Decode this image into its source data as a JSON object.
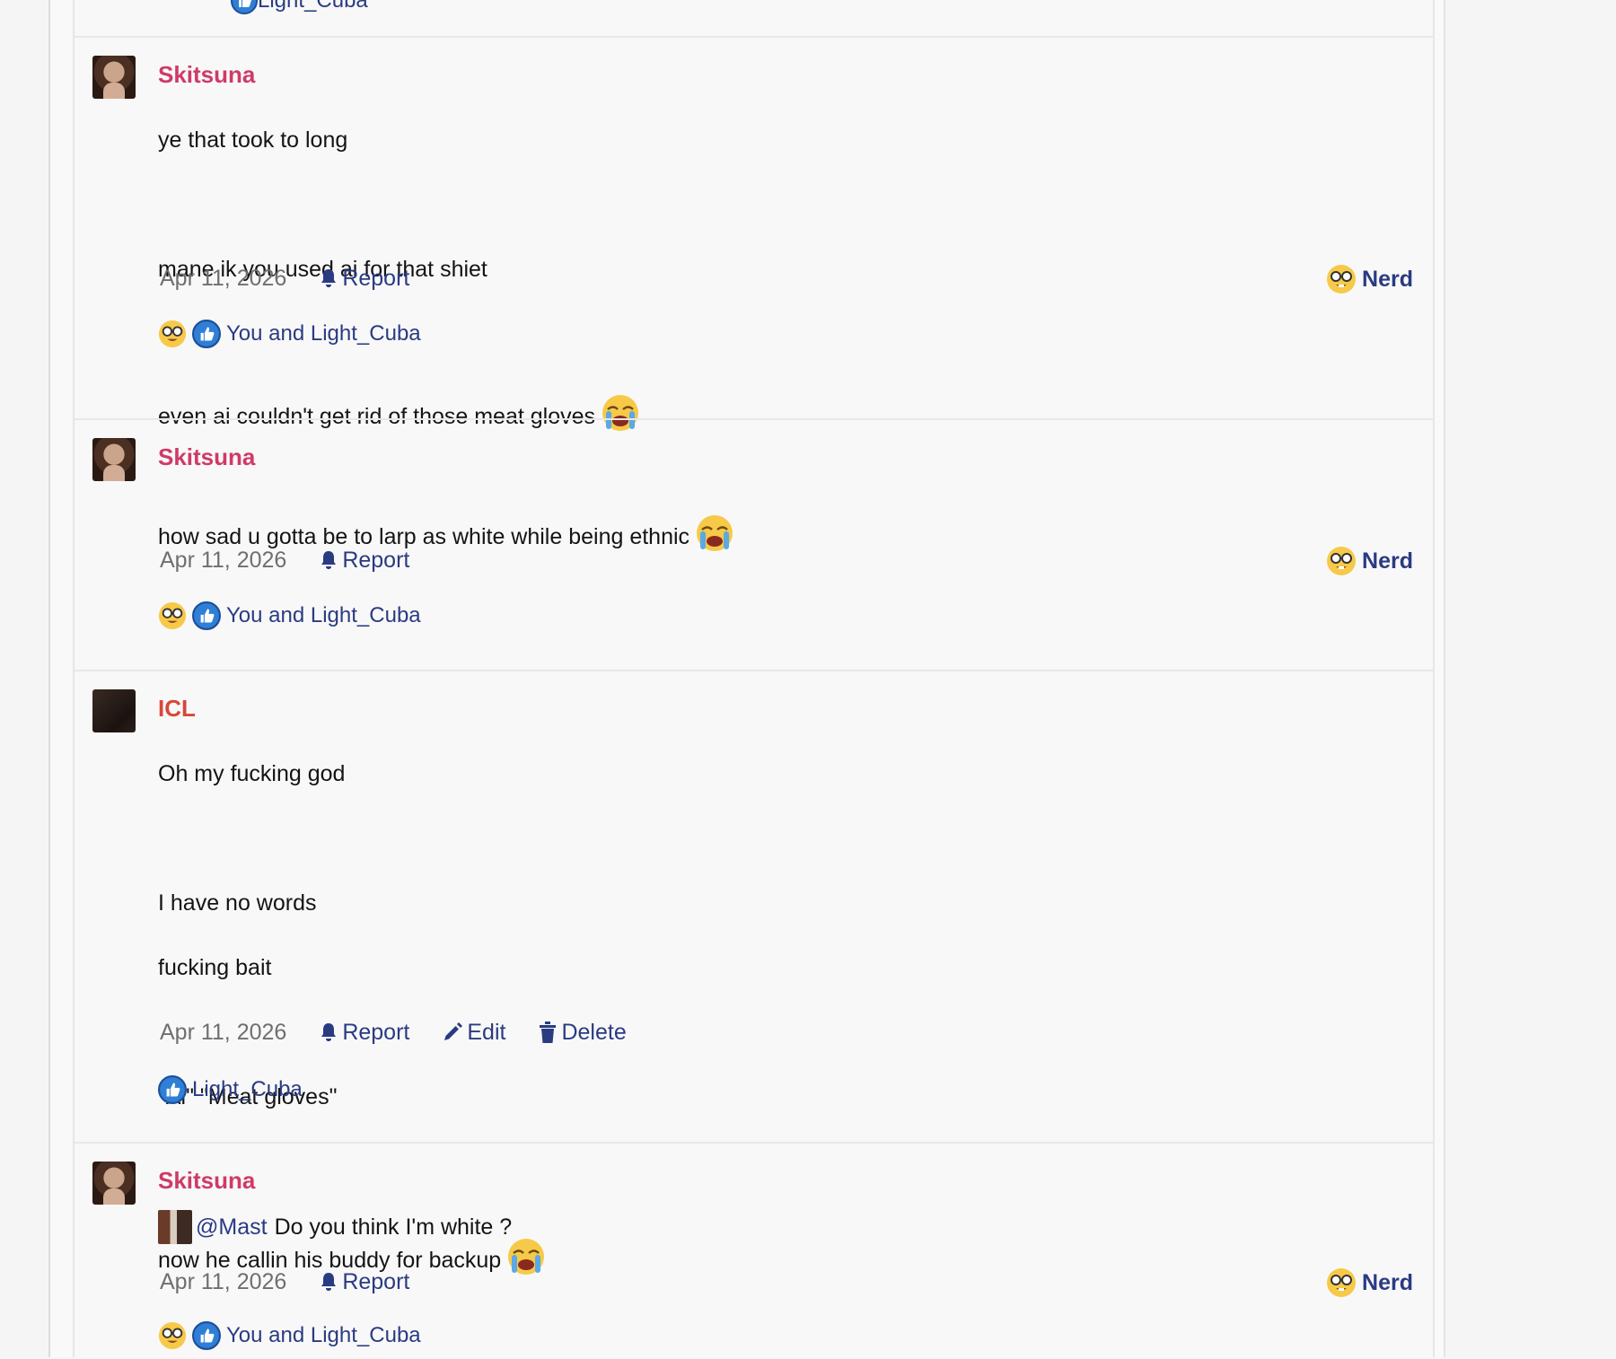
{
  "top_partial": {
    "reaction_text": "Light_Cuba"
  },
  "comments": [
    {
      "username": "Skitsuna",
      "lines": [
        "ye that took to long",
        "",
        "mane ik you used ai for that shiet",
        "",
        "even ai couldn't get rid of those meat gloves"
      ],
      "date": "Apr 11, 2026",
      "report_label": "Report",
      "nerd_label": "Nerd",
      "reactions_text": "You and Light_Cuba"
    },
    {
      "username": "Skitsuna",
      "lines": [
        "how sad u gotta be to larp as white while being ethnic"
      ],
      "date": "Apr 11, 2026",
      "report_label": "Report",
      "nerd_label": "Nerd",
      "reactions_text": "You and Light_Cuba"
    },
    {
      "username": "ICL",
      "lines": [
        "Oh my fucking god",
        "",
        "I have no words",
        "fucking bait",
        "",
        "\"Ai\" \"Meat gloves\""
      ],
      "mention": "@Mast",
      "mention_text": "Do you think I'm white ?",
      "date": "Apr 11, 2026",
      "report_label": "Report",
      "edit_label": "Edit",
      "delete_label": "Delete",
      "reactions_text": "Light_Cuba"
    },
    {
      "username": "Skitsuna",
      "lines": [
        "now he callin his buddy for backup"
      ],
      "date": "Apr 11, 2026",
      "report_label": "Report",
      "nerd_label": "Nerd",
      "reactions_text": "You and Light_Cuba"
    }
  ],
  "icons": {
    "cry": "loudly-crying-face-emoji",
    "nerd": "nerd-face-emoji",
    "like": "thumbs-up-icon",
    "report": "bell-icon",
    "edit": "pencil-icon",
    "delete": "trash-icon"
  },
  "colors": {
    "username_skitsuna": "#cf3a67",
    "username_icl": "#d9463a",
    "link": "#2a3b82",
    "date": "#6f6f6f"
  }
}
